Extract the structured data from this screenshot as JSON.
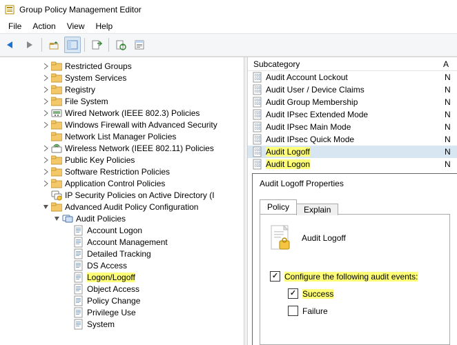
{
  "title": "Group Policy Management Editor",
  "menu": {
    "file": "File",
    "action": "Action",
    "view": "View",
    "help": "Help"
  },
  "tree": [
    {
      "depth": 3,
      "exp": ">",
      "icon": "folder",
      "label": "Restricted Groups"
    },
    {
      "depth": 3,
      "exp": ">",
      "icon": "folder",
      "label": "System Services"
    },
    {
      "depth": 3,
      "exp": ">",
      "icon": "folder",
      "label": "Registry"
    },
    {
      "depth": 3,
      "exp": ">",
      "icon": "folder",
      "label": "File System"
    },
    {
      "depth": 3,
      "exp": ">",
      "icon": "wired",
      "label": "Wired Network (IEEE 802.3) Policies"
    },
    {
      "depth": 3,
      "exp": ">",
      "icon": "folder",
      "label": "Windows Firewall with Advanced Security"
    },
    {
      "depth": 3,
      "exp": "",
      "icon": "folder",
      "label": "Network List Manager Policies"
    },
    {
      "depth": 3,
      "exp": ">",
      "icon": "wireless",
      "label": "Wireless Network (IEEE 802.11) Policies"
    },
    {
      "depth": 3,
      "exp": ">",
      "icon": "folder",
      "label": "Public Key Policies"
    },
    {
      "depth": 3,
      "exp": ">",
      "icon": "folder",
      "label": "Software Restriction Policies"
    },
    {
      "depth": 3,
      "exp": ">",
      "icon": "folder",
      "label": "Application Control Policies"
    },
    {
      "depth": 3,
      "exp": "",
      "icon": "ipsec",
      "label": "IP Security Policies on Active Directory (I"
    },
    {
      "depth": 3,
      "exp": "v",
      "icon": "folder",
      "label": "Advanced Audit Policy Configuration"
    },
    {
      "depth": 4,
      "exp": "v",
      "icon": "audit",
      "label": "Audit Policies"
    },
    {
      "depth": 5,
      "exp": "",
      "icon": "sheet",
      "label": "Account Logon"
    },
    {
      "depth": 5,
      "exp": "",
      "icon": "sheet",
      "label": "Account Management"
    },
    {
      "depth": 5,
      "exp": "",
      "icon": "sheet",
      "label": "Detailed Tracking"
    },
    {
      "depth": 5,
      "exp": "",
      "icon": "sheet",
      "label": "DS Access"
    },
    {
      "depth": 5,
      "exp": "",
      "icon": "sheet",
      "label": "Logon/Logoff",
      "hl": true
    },
    {
      "depth": 5,
      "exp": "",
      "icon": "sheet",
      "label": "Object Access"
    },
    {
      "depth": 5,
      "exp": "",
      "icon": "sheet",
      "label": "Policy Change"
    },
    {
      "depth": 5,
      "exp": "",
      "icon": "sheet",
      "label": "Privilege Use"
    },
    {
      "depth": 5,
      "exp": "",
      "icon": "sheet",
      "label": "System"
    }
  ],
  "list": {
    "header": "Subcategory",
    "header2": "A",
    "items": [
      {
        "label": "Audit Account Lockout",
        "v": "N"
      },
      {
        "label": "Audit User / Device Claims",
        "v": "N"
      },
      {
        "label": "Audit Group Membership",
        "v": "N"
      },
      {
        "label": "Audit IPsec Extended Mode",
        "v": "N"
      },
      {
        "label": "Audit IPsec Main Mode",
        "v": "N"
      },
      {
        "label": "Audit IPsec Quick Mode",
        "v": "N"
      },
      {
        "label": "Audit Logoff",
        "v": "N",
        "sel": true,
        "hl": true
      },
      {
        "label": "Audit Logon",
        "v": "N",
        "hl": true
      }
    ]
  },
  "dialog": {
    "title": "Audit Logoff Properties",
    "tabs": {
      "policy": "Policy",
      "explain": "Explain"
    },
    "heading": "Audit Logoff",
    "configure": "Configure the following audit events:",
    "success": "Success",
    "failure": "Failure"
  }
}
